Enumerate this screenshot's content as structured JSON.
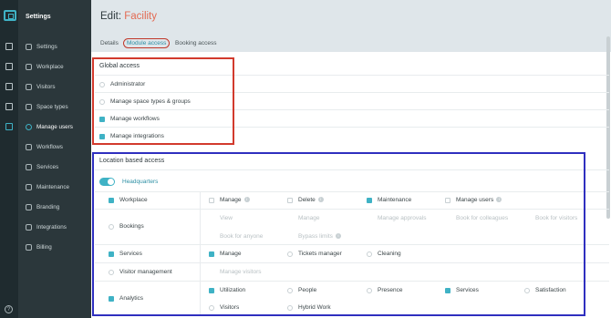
{
  "sidebar": {
    "title": "Settings",
    "items": [
      {
        "label": "Settings",
        "icon": "gear-icon"
      },
      {
        "label": "Workplace",
        "icon": "desk-icon"
      },
      {
        "label": "Visitors",
        "icon": "badge-icon"
      },
      {
        "label": "Space types",
        "icon": "location-icon"
      },
      {
        "label": "Manage users",
        "icon": "users-icon"
      },
      {
        "label": "Workflows",
        "icon": "chat-icon"
      },
      {
        "label": "Services",
        "icon": "services-icon"
      },
      {
        "label": "Maintenance",
        "icon": "wrench-icon"
      },
      {
        "label": "Branding",
        "icon": "brush-icon"
      },
      {
        "label": "Integrations",
        "icon": "integrations-icon"
      },
      {
        "label": "Billing",
        "icon": "card-icon"
      }
    ],
    "active_index": 4,
    "help_glyph": "?"
  },
  "header": {
    "title_prefix": "Edit:",
    "title_entity": "Facility",
    "tabs": [
      "Details",
      "Module access",
      "Booking access"
    ],
    "active_tab": 1
  },
  "global_access": {
    "title": "Global access",
    "items": [
      {
        "label": "Administrator",
        "checked": false
      },
      {
        "label": "Manage space types & groups",
        "checked": false
      },
      {
        "label": "Manage workflows",
        "checked": true
      },
      {
        "label": "Manage integrations",
        "checked": true
      }
    ]
  },
  "location_access": {
    "title": "Location based access",
    "location": "Headquarters",
    "location_enabled": true,
    "modules": [
      {
        "name": "Workplace",
        "checked": true,
        "options": [
          {
            "label": "Manage",
            "checked": false,
            "info": true
          },
          {
            "label": "Delete",
            "checked": false,
            "info": true
          },
          {
            "label": "Maintenance",
            "checked": true,
            "info": false
          },
          {
            "label": "Manage users",
            "checked": false,
            "info": true
          }
        ]
      },
      {
        "name": "Bookings",
        "checked": false,
        "options": [
          {
            "label": "View"
          },
          {
            "label": "Manage"
          },
          {
            "label": "Manage approvals"
          },
          {
            "label": "Book for colleagues"
          },
          {
            "label": "Book for visitors"
          },
          {
            "label": "Book for anyone"
          },
          {
            "label": "Bypass limits",
            "info": true
          }
        ]
      },
      {
        "name": "Services",
        "checked": true,
        "options": [
          {
            "label": "Manage",
            "checked": true
          },
          {
            "label": "Tickets manager",
            "checked": false
          },
          {
            "label": "Cleaning",
            "checked": false
          }
        ]
      },
      {
        "name": "Visitor management",
        "checked": false,
        "options": [
          {
            "label": "Manage visitors"
          }
        ]
      },
      {
        "name": "Analytics",
        "checked": true,
        "options": [
          {
            "label": "Utilization",
            "checked": true
          },
          {
            "label": "People",
            "checked": false
          },
          {
            "label": "Presence",
            "checked": false
          },
          {
            "label": "Services",
            "checked": true
          },
          {
            "label": "Satisfaction",
            "checked": false
          },
          {
            "label": "Visitors",
            "checked": false
          },
          {
            "label": "Hybrid Work",
            "checked": false
          }
        ]
      }
    ]
  },
  "colors": {
    "accent": "#3fb2c5",
    "entity": "#e36a52",
    "sidebar": "#2b373b",
    "annotation_red": "#d23a2d",
    "annotation_blue": "#2f2fbf"
  }
}
